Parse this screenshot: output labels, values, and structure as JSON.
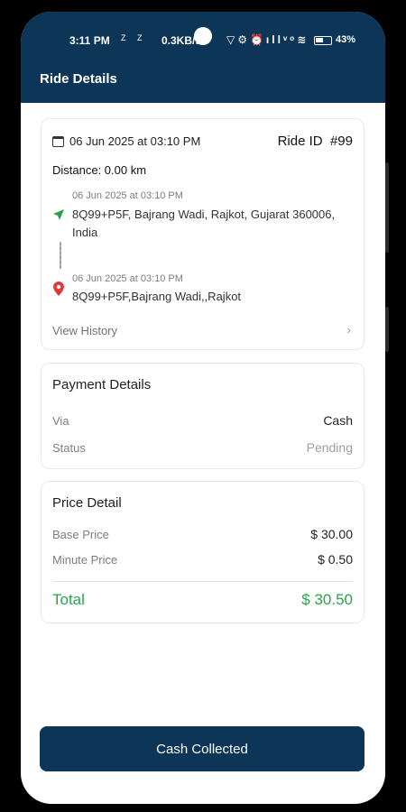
{
  "status_bar": {
    "time": "3:11 PM",
    "mini_icons": "Z Z",
    "speed": "0.3KB/s",
    "icons": "▽⚙⏰ıllᵛᵒ≋",
    "battery_pct": "43%"
  },
  "header": {
    "title": "Ride Details"
  },
  "ride": {
    "date": "06 Jun 2025 at 03:10 PM",
    "ride_id_label": "Ride ID",
    "ride_id": "#99",
    "distance": "Distance: 0.00 km",
    "pickup_time": "06 Jun 2025 at 03:10 PM",
    "pickup_address": "8Q99+P5F, Bajrang Wadi, Rajkot, Gujarat 360006, India",
    "drop_time": "06 Jun 2025 at 03:10 PM",
    "drop_address": "8Q99+P5F,Bajrang Wadi,,Rajkot",
    "view_history": "View History"
  },
  "payment": {
    "title": "Payment Details",
    "via_label": "Via",
    "via_value": "Cash",
    "status_label": "Status",
    "status_value": "Pending"
  },
  "price": {
    "title": "Price Detail",
    "base_label": "Base Price",
    "base_value": "$ 30.00",
    "minute_label": "Minute Price",
    "minute_value": "$ 0.50",
    "total_label": "Total",
    "total_value": "$ 30.50"
  },
  "actions": {
    "cash_collected": "Cash Collected"
  },
  "colors": {
    "primary": "#0d3557",
    "success": "#2aa44a",
    "danger": "#e53935"
  },
  "icons": {
    "calendar": "calendar-icon",
    "pickup": "navigation-arrow-icon",
    "drop": "location-pin-icon",
    "chevron": "chevron-right-icon"
  }
}
